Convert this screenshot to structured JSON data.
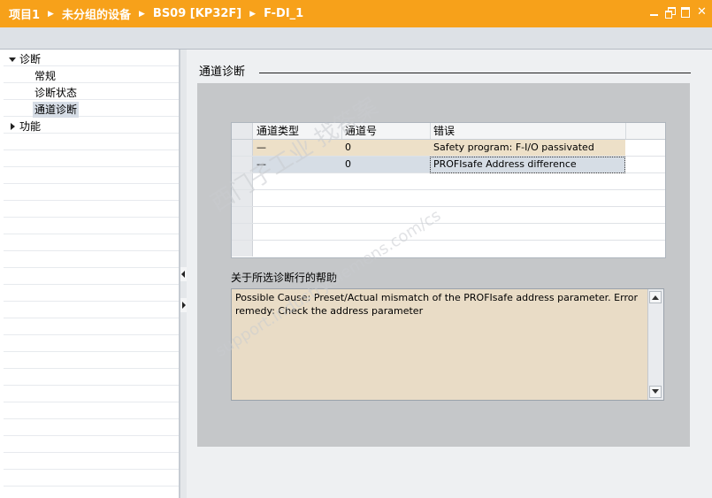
{
  "breadcrumb": {
    "items": [
      "项目1",
      "未分组的设备",
      "BS09 [KP32F]",
      "F-DI_1"
    ],
    "separator": "▶"
  },
  "colors": {
    "title_bar": "#f7a11a",
    "row_peach": "#ede0c8",
    "row_selected": "#d6dde5",
    "help_bg": "#e9dcc6",
    "panel_bg": "#c5c7c9"
  },
  "window_controls": {
    "minimize_icon": "minimize-icon",
    "float_icon": "float-window-icon",
    "maximize_icon": "maximize-icon",
    "close_glyph": "✕"
  },
  "nav": {
    "diagnostics": "诊断",
    "general": "常规",
    "diag_status": "诊断状态",
    "channel_diag": "通道诊断",
    "functions": "功能"
  },
  "section": {
    "title": "通道诊断"
  },
  "grid": {
    "headers": [
      "通道类型",
      "通道号",
      "错误"
    ],
    "rows": [
      {
        "type": "—",
        "number": "0",
        "error": "Safety program: F-I/O passivated"
      },
      {
        "type": "—",
        "number": "0",
        "error": "PROFIsafe Address difference"
      }
    ]
  },
  "help": {
    "label": "关于所选诊断行的帮助",
    "text": "Possible Cause: Preset/Actual mismatch of the PROFIsafe address parameter. Error remedy: Check the address parameter"
  },
  "watermark": {
    "line1": "西门子工业  找答案",
    "line2": "support.industry.siemens.com/cs"
  }
}
